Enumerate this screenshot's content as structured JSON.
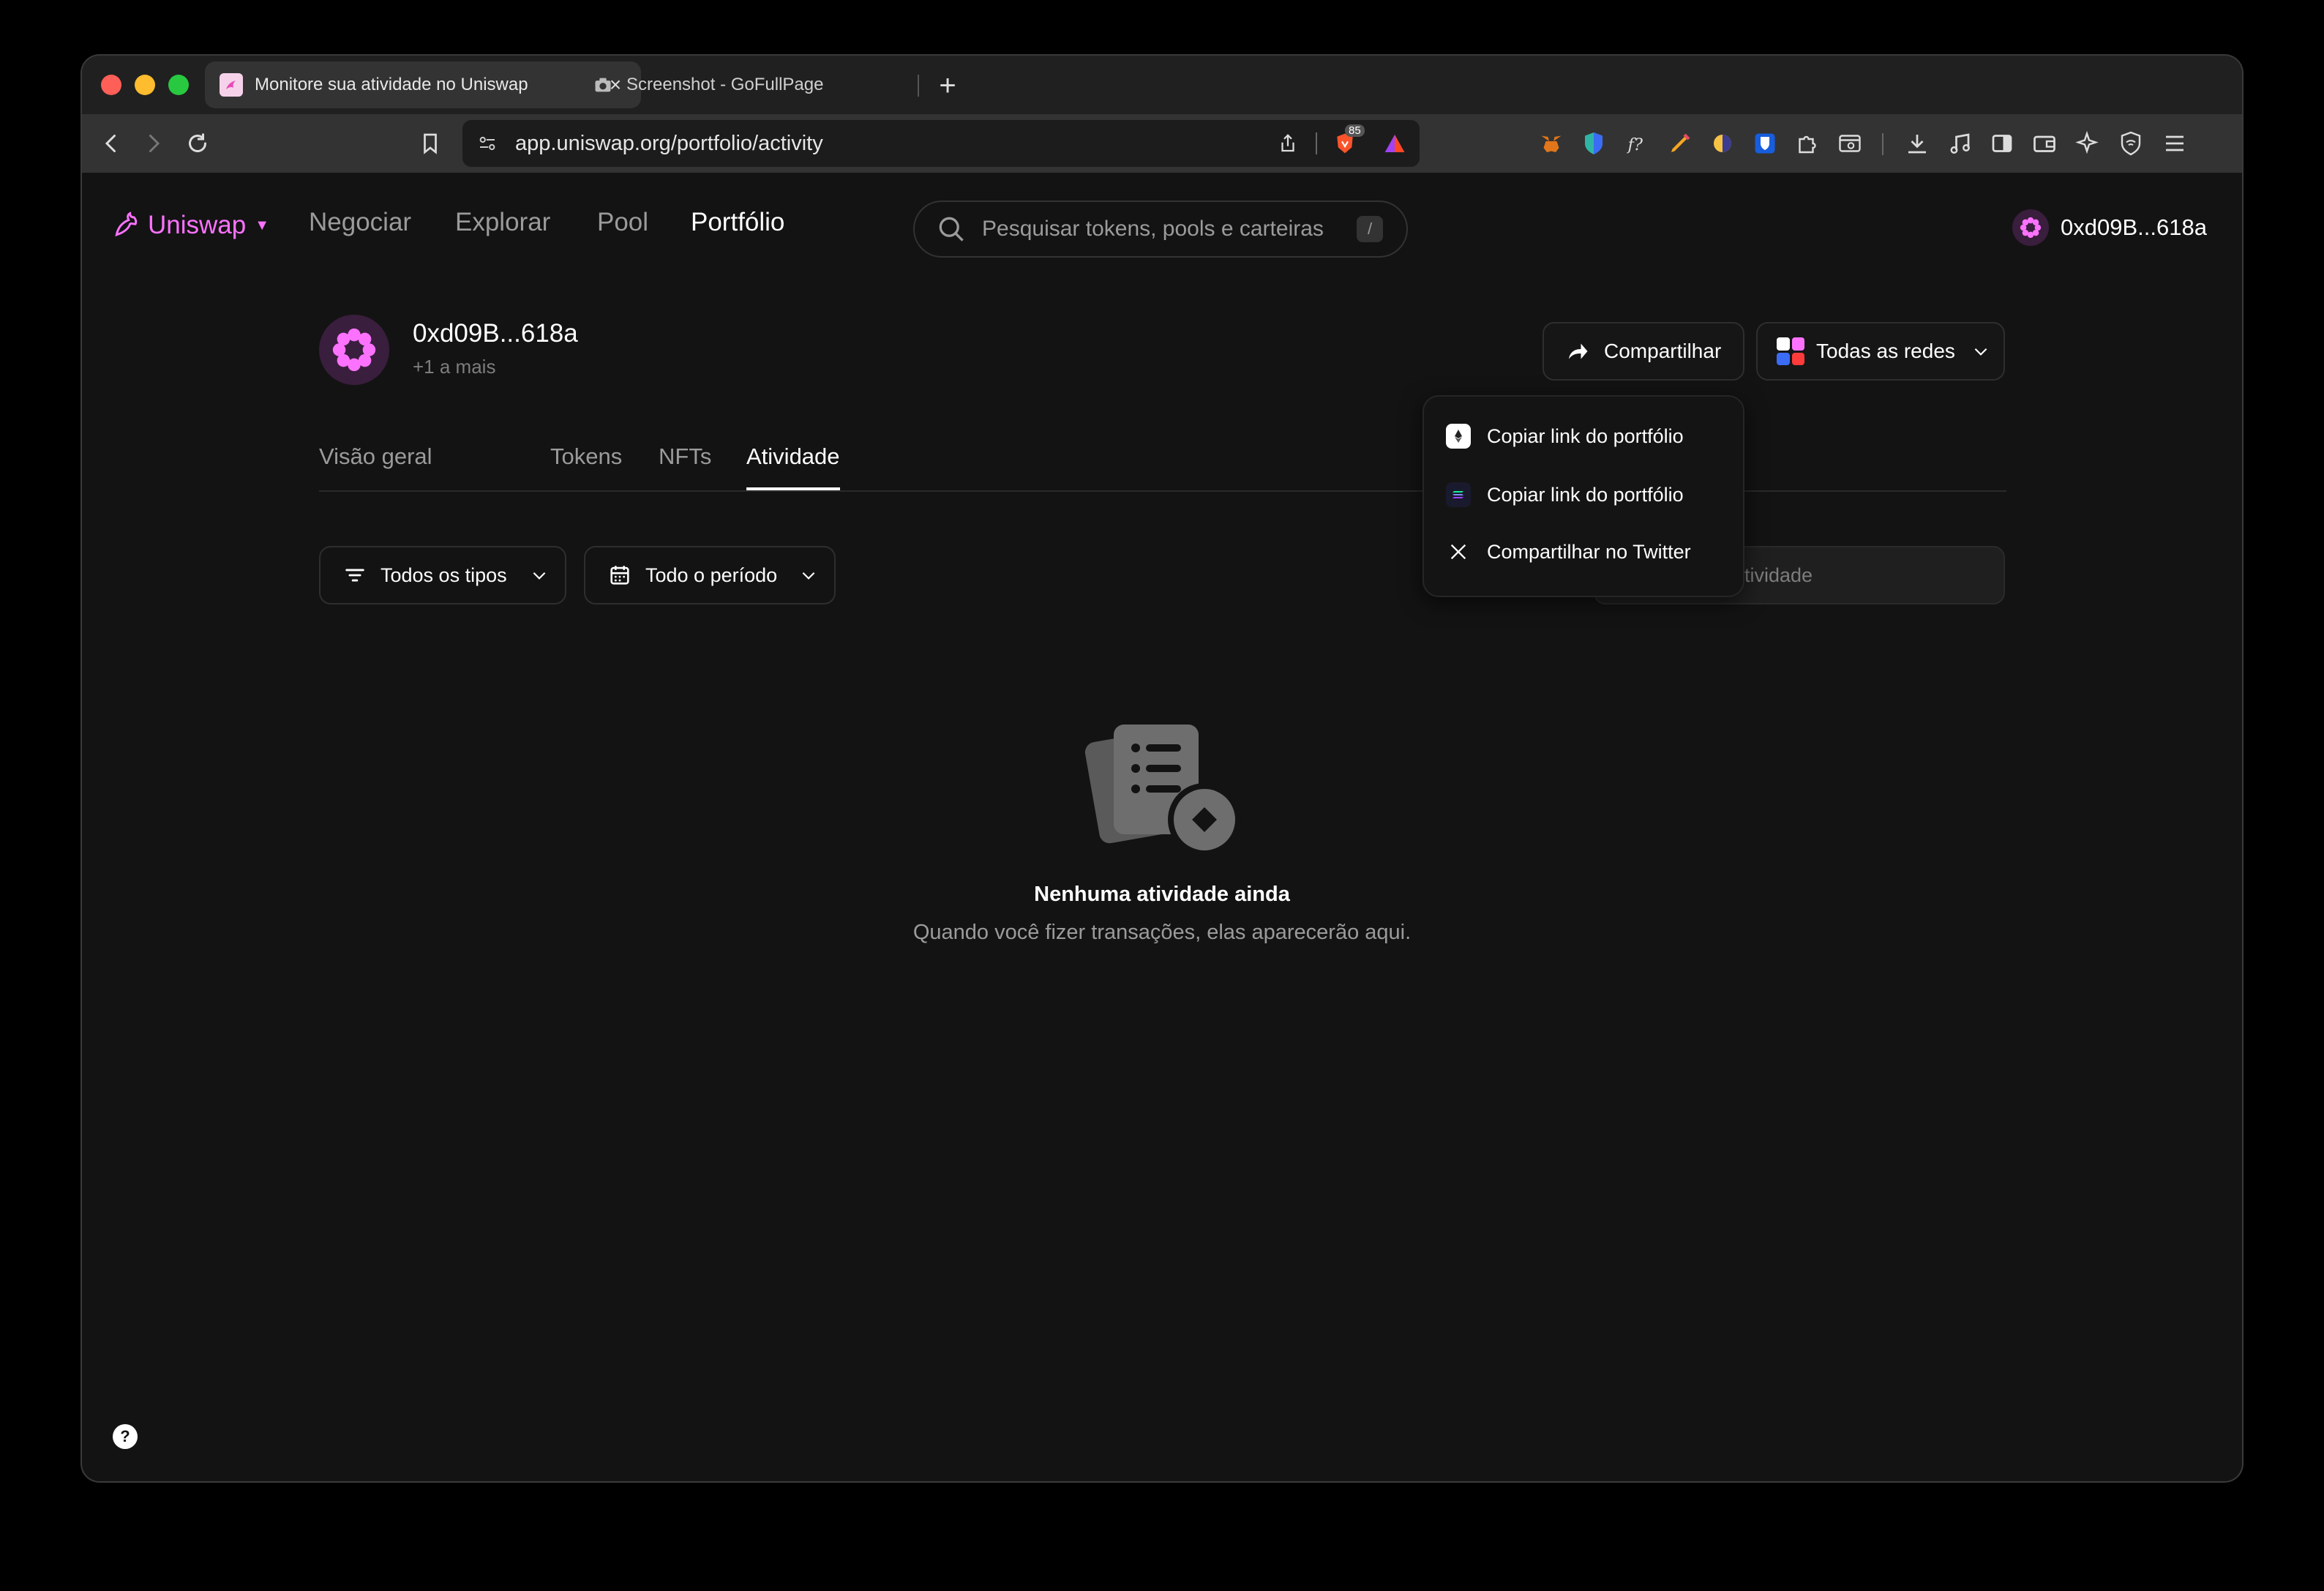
{
  "browser": {
    "tabs": [
      {
        "title": "Monitore sua atividade no Uniswap",
        "active": true
      },
      {
        "title": "Screenshot - GoFullPage",
        "active": false
      }
    ],
    "url": "app.uniswap.org/portfolio/activity",
    "brave_badge": "85"
  },
  "header": {
    "logo": "Uniswap",
    "nav": [
      "Negociar",
      "Explorar",
      "Pool",
      "Portfólio"
    ],
    "active_nav": "Portfólio",
    "search_placeholder": "Pesquisar tokens, pools e carteiras",
    "search_shortcut": "/",
    "account": "0xd09B...618a"
  },
  "portfolio": {
    "address": "0xd09B...618a",
    "more": "+1 a mais",
    "share_label": "Compartilhar",
    "networks_label": "Todas as redes",
    "tabs": [
      "Visão geral",
      "Tokens",
      "NFTs",
      "Atividade"
    ],
    "active_tab": "Atividade"
  },
  "filters": {
    "types": "Todos os tipos",
    "period": "Todo o período",
    "search_placeholder_visible": "tividade"
  },
  "share_menu": {
    "items": [
      {
        "label": "Copiar link do portfólio",
        "icon": "ethereum-icon"
      },
      {
        "label": "Copiar link do portfólio",
        "icon": "solana-icon"
      },
      {
        "label": "Compartilhar no Twitter",
        "icon": "x-twitter-icon"
      }
    ]
  },
  "empty_state": {
    "title": "Nenhuma atividade ainda",
    "subtitle": "Quando você fizer transações, elas aparecerão aqui."
  },
  "help_label": "?",
  "colors": {
    "brand_pink": "#fc72ff",
    "background": "#131313",
    "muted_text": "#9b9b9b"
  }
}
